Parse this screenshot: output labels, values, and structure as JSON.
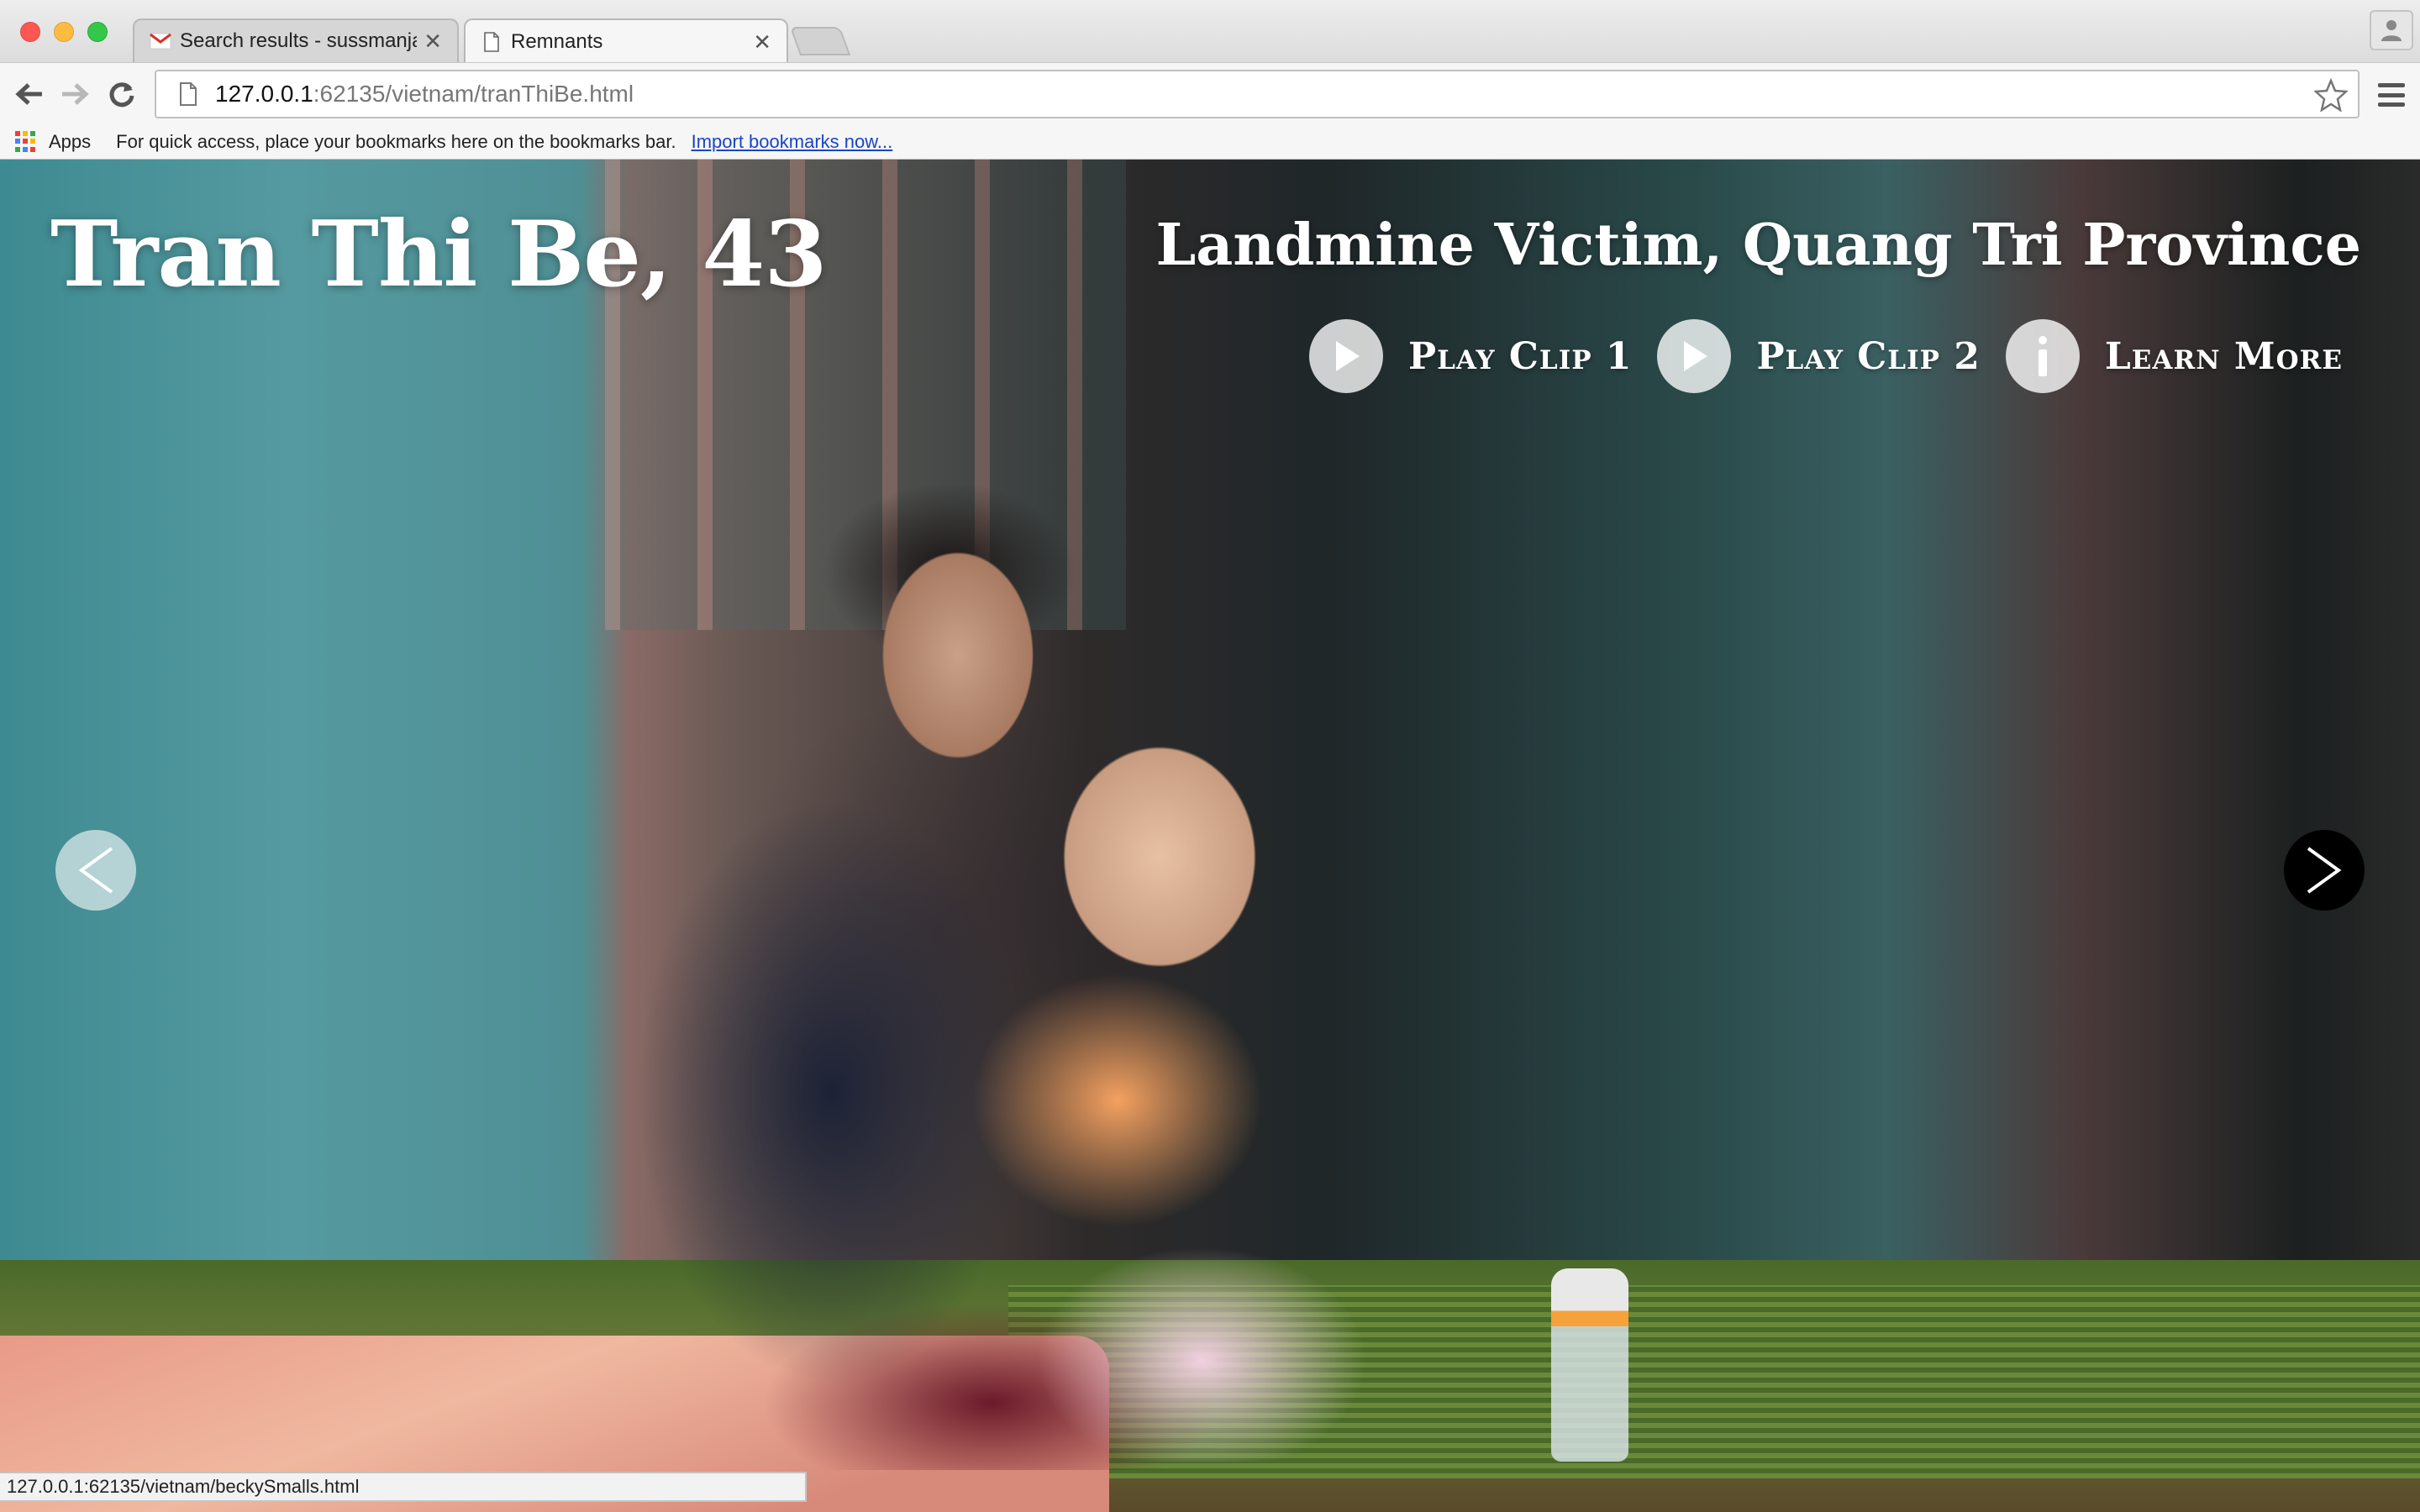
{
  "browser": {
    "tabs": [
      {
        "title": "Search results - sussmanja",
        "icon": "gmail-icon",
        "active": false
      },
      {
        "title": "Remnants",
        "icon": "page-icon",
        "active": true
      }
    ],
    "address": {
      "host": "127.0.0.1",
      "rest": ":62135/vietnam/tranThiBe.html"
    },
    "bookmarks": {
      "apps_label": "Apps",
      "message": "For quick access, place your bookmarks here on the bookmarks bar.",
      "import_link": "Import bookmarks now..."
    },
    "status_url": "127.0.0.1:62135/vietnam/beckySmalls.html"
  },
  "page": {
    "name_title": "Tran Thi Be, 43",
    "subtitle": "Landmine Victim, Quang Tri Province",
    "actions": [
      {
        "label": "Play Clip 1",
        "icon": "play-icon"
      },
      {
        "label": "Play Clip 2",
        "icon": "play-icon"
      },
      {
        "label": "Learn More",
        "icon": "info-icon"
      }
    ],
    "prev_icon": "chevron-left-icon",
    "next_icon": "chevron-right-icon"
  },
  "colors": {
    "link": "#1a45c8",
    "action_circle": "#ffffffc7",
    "traffic_red": "#fc5753",
    "traffic_yellow": "#fdbc40",
    "traffic_green": "#34c84a"
  }
}
